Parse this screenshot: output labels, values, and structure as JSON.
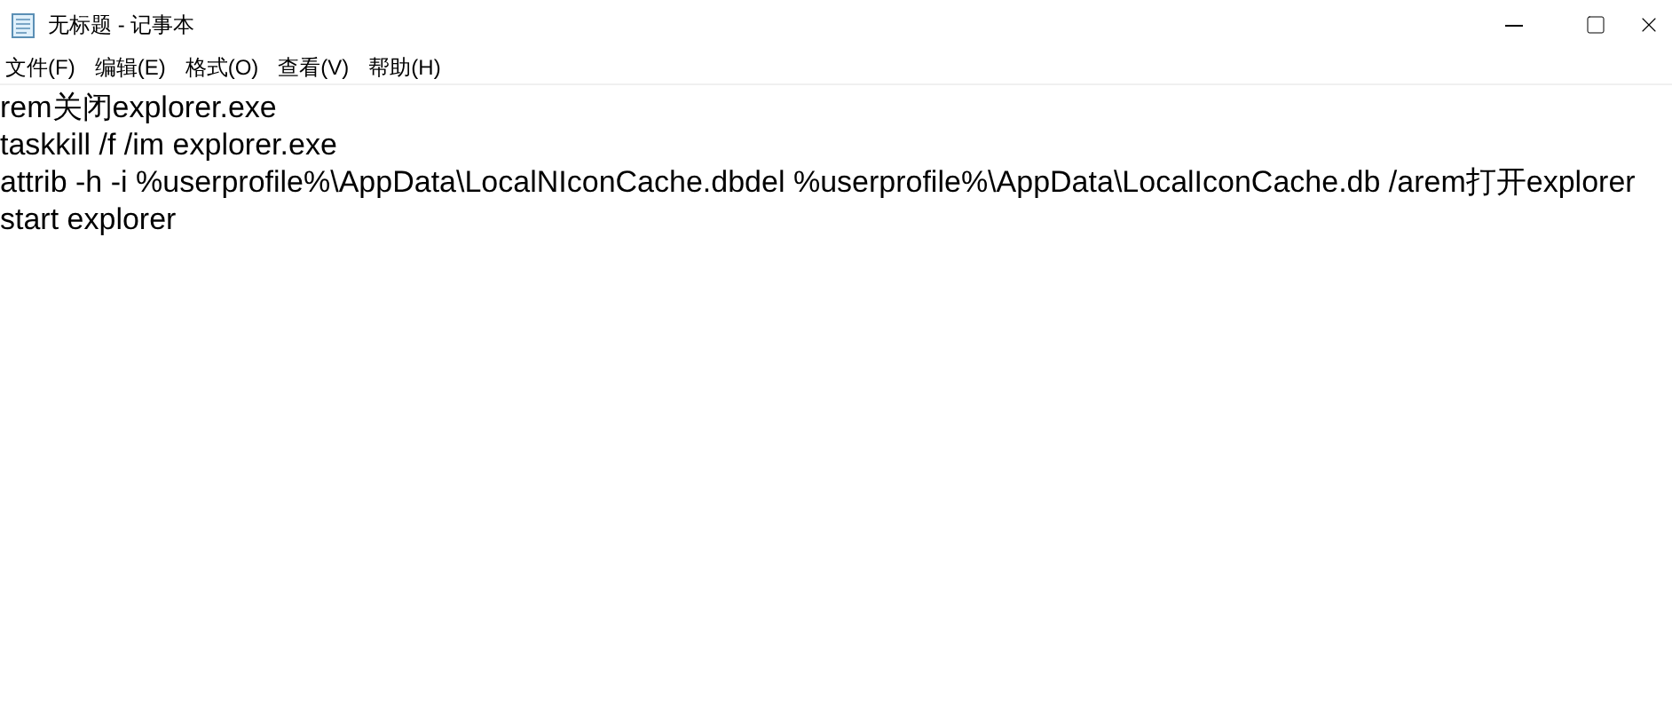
{
  "window": {
    "title": "无标题 - 记事本"
  },
  "menu": [
    "文件(F)",
    "编辑(E)",
    "格式(O)",
    "查看(V)",
    "帮助(H)"
  ],
  "editor": {
    "lines": [
      "rem关闭explorer.exe",
      "taskkill /f /im explorer.exe",
      "attrib -h -i %userprofile%\\AppData\\LocalNIconCache.dbdel %userprofile%\\AppData\\LocalIconCache.db /arem打开explorer",
      "start explorer"
    ]
  }
}
